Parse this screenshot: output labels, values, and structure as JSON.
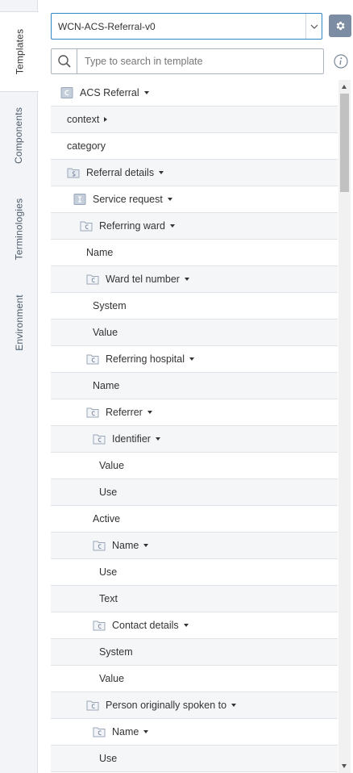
{
  "side_tabs": [
    {
      "label": "Templates",
      "active": true
    },
    {
      "label": "Components",
      "active": false
    },
    {
      "label": "Terminologies",
      "active": false
    },
    {
      "label": "Environment",
      "active": false
    }
  ],
  "template_select": {
    "value": "WCN-ACS-Referral-v0"
  },
  "search": {
    "placeholder": "Type to search in template"
  },
  "tree": [
    {
      "label": "ACS Referral",
      "icon": "composition-icon",
      "dropdown": "down"
    },
    {
      "label": "context",
      "icon": "",
      "dropdown": "right"
    },
    {
      "label": "category",
      "icon": "",
      "dropdown": ""
    },
    {
      "label": "Referral details",
      "icon": "section-icon",
      "dropdown": "down"
    },
    {
      "label": "Service request",
      "icon": "instruction-icon",
      "dropdown": "down"
    },
    {
      "label": "Referring ward",
      "icon": "cluster-icon",
      "dropdown": "down"
    },
    {
      "label": "Name",
      "icon": "",
      "dropdown": ""
    },
    {
      "label": "Ward tel number",
      "icon": "cluster-icon",
      "dropdown": "down"
    },
    {
      "label": "System",
      "icon": "",
      "dropdown": ""
    },
    {
      "label": "Value",
      "icon": "",
      "dropdown": ""
    },
    {
      "label": "Referring hospital",
      "icon": "cluster-icon",
      "dropdown": "down"
    },
    {
      "label": "Name",
      "icon": "",
      "dropdown": ""
    },
    {
      "label": "Referrer",
      "icon": "cluster-icon",
      "dropdown": "down"
    },
    {
      "label": "Identifier",
      "icon": "cluster-icon",
      "dropdown": "down"
    },
    {
      "label": "Value",
      "icon": "",
      "dropdown": ""
    },
    {
      "label": "Use",
      "icon": "",
      "dropdown": ""
    },
    {
      "label": "Active",
      "icon": "",
      "dropdown": ""
    },
    {
      "label": "Name",
      "icon": "cluster-icon",
      "dropdown": "down"
    },
    {
      "label": "Use",
      "icon": "",
      "dropdown": ""
    },
    {
      "label": "Text",
      "icon": "",
      "dropdown": ""
    },
    {
      "label": "Contact details",
      "icon": "cluster-icon",
      "dropdown": "down"
    },
    {
      "label": "System",
      "icon": "",
      "dropdown": ""
    },
    {
      "label": "Value",
      "icon": "",
      "dropdown": ""
    },
    {
      "label": "Person originally spoken to",
      "icon": "cluster-icon",
      "dropdown": "down"
    },
    {
      "label": "Name",
      "icon": "cluster-icon",
      "dropdown": "down"
    },
    {
      "label": "Use",
      "icon": "",
      "dropdown": ""
    }
  ],
  "colors": {
    "accent": "#2f86c7",
    "gear_button": "#7b8ca3",
    "icon_fill": "#c5cfdc",
    "icon_stroke": "#9aa7b8"
  }
}
